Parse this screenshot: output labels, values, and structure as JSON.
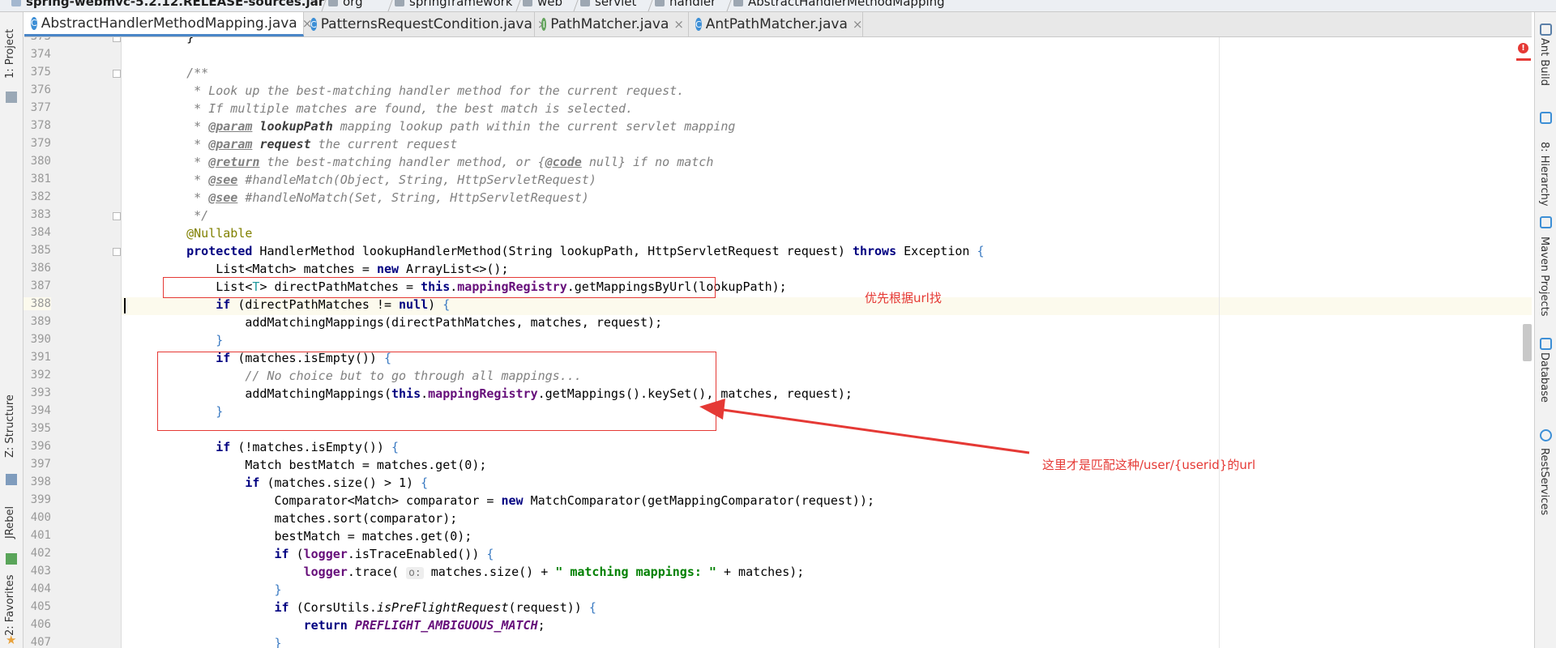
{
  "breadcrumb": [
    {
      "label": "spring-webmvc-5.2.12.RELEASE-sources.jar",
      "icon": "jar-icon"
    },
    {
      "label": "org",
      "icon": "package-icon"
    },
    {
      "label": "springframework",
      "icon": "package-icon"
    },
    {
      "label": "web",
      "icon": "package-icon"
    },
    {
      "label": "servlet",
      "icon": "package-icon"
    },
    {
      "label": "handler",
      "icon": "package-icon"
    },
    {
      "label": "AbstractHandlerMethodMapping",
      "icon": "class-icon"
    }
  ],
  "tabs": [
    {
      "label": "AbstractHandlerMethodMapping.java",
      "icon": "class-icon",
      "active": true
    },
    {
      "label": "PatternsRequestCondition.java",
      "icon": "class-icon",
      "active": false
    },
    {
      "label": "PathMatcher.java",
      "icon": "interface-icon",
      "active": false
    },
    {
      "label": "AntPathMatcher.java",
      "icon": "class-icon",
      "active": false
    }
  ],
  "left_tools": [
    {
      "label": "1: Project",
      "icon": "folder-icon"
    },
    {
      "label": "Z: Structure",
      "icon": "structure-icon"
    },
    {
      "label": "JRebel",
      "icon": "jrebel-icon"
    },
    {
      "label": "2: Favorites",
      "icon": "star-icon"
    }
  ],
  "right_tools": [
    {
      "label": "Ant Build",
      "icon": "ant-icon"
    },
    {
      "label": "8: Hierarchy",
      "icon": "hierarchy-icon"
    },
    {
      "label": "Maven Projects",
      "icon": "maven-icon"
    },
    {
      "label": "Database",
      "icon": "database-icon"
    },
    {
      "label": "RestServices",
      "icon": "rest-icon"
    }
  ],
  "editor": {
    "current_line": "388",
    "lines": [
      {
        "n": "373",
        "t": [
          {
            "c": "",
            "v": "    }"
          }
        ]
      },
      {
        "n": "374",
        "t": []
      },
      {
        "n": "375",
        "t": [
          {
            "c": "c",
            "v": "    /**"
          }
        ]
      },
      {
        "n": "376",
        "t": [
          {
            "c": "c",
            "v": "     * Look up the best-matching handler method for the current request."
          }
        ]
      },
      {
        "n": "377",
        "t": [
          {
            "c": "c",
            "v": "     * If multiple matches are found, the best match is selected."
          }
        ]
      },
      {
        "n": "378",
        "t": [
          {
            "c": "c",
            "v": "     * "
          },
          {
            "c": "cd",
            "v": "@param"
          },
          {
            "c": "c",
            "v": " "
          },
          {
            "c": "cb",
            "v": "lookupPath"
          },
          {
            "c": "c",
            "v": " mapping lookup path within the current servlet mapping"
          }
        ]
      },
      {
        "n": "379",
        "t": [
          {
            "c": "c",
            "v": "     * "
          },
          {
            "c": "cd",
            "v": "@param"
          },
          {
            "c": "c",
            "v": " "
          },
          {
            "c": "cb",
            "v": "request"
          },
          {
            "c": "c",
            "v": " the current request"
          }
        ]
      },
      {
        "n": "380",
        "t": [
          {
            "c": "c",
            "v": "     * "
          },
          {
            "c": "cd",
            "v": "@return"
          },
          {
            "c": "c",
            "v": " the best-matching handler method, or {"
          },
          {
            "c": "cd",
            "v": "@code"
          },
          {
            "c": "c",
            "v": " null} if no match"
          }
        ]
      },
      {
        "n": "381",
        "t": [
          {
            "c": "c",
            "v": "     * "
          },
          {
            "c": "cd",
            "v": "@see"
          },
          {
            "c": "c",
            "v": " #handleMatch(Object, String, HttpServletRequest)"
          }
        ]
      },
      {
        "n": "382",
        "t": [
          {
            "c": "c",
            "v": "     * "
          },
          {
            "c": "cd",
            "v": "@see"
          },
          {
            "c": "c",
            "v": " #handleNoMatch(Set, String, HttpServletRequest)"
          }
        ]
      },
      {
        "n": "383",
        "t": [
          {
            "c": "c",
            "v": "     */"
          }
        ]
      },
      {
        "n": "384",
        "t": [
          {
            "c": "an",
            "v": "    @Nullable"
          }
        ]
      },
      {
        "n": "385",
        "t": [
          {
            "c": "k",
            "v": "    protected"
          },
          {
            "c": "",
            "v": " HandlerMethod lookupHandlerMethod(String lookupPath, HttpServletRequest request) "
          },
          {
            "c": "k",
            "v": "throws"
          },
          {
            "c": "",
            "v": " Exception "
          },
          {
            "c": "br",
            "v": "{"
          }
        ]
      },
      {
        "n": "386",
        "t": [
          {
            "c": "",
            "v": "        List<Match> matches = "
          },
          {
            "c": "k",
            "v": "new"
          },
          {
            "c": "",
            "v": " ArrayList<>();"
          }
        ]
      },
      {
        "n": "387",
        "t": [
          {
            "c": "",
            "v": "        List<"
          },
          {
            "c": "g",
            "v": "T"
          },
          {
            "c": "",
            "v": "> directPathMatches = "
          },
          {
            "c": "k",
            "v": "this"
          },
          {
            "c": "",
            "v": "."
          },
          {
            "c": "f",
            "v": "mappingRegistry"
          },
          {
            "c": "",
            "v": ".getMappingsByUrl(lookupPath);"
          }
        ]
      },
      {
        "n": "388",
        "t": [
          {
            "c": "k",
            "v": "        if"
          },
          {
            "c": "",
            "v": " (directPathMatches != "
          },
          {
            "c": "k",
            "v": "null"
          },
          {
            "c": "",
            "v": ") "
          },
          {
            "c": "br",
            "v": "{"
          }
        ]
      },
      {
        "n": "389",
        "t": [
          {
            "c": "",
            "v": "            addMatchingMappings(directPathMatches, matches, request);"
          }
        ]
      },
      {
        "n": "390",
        "t": [
          {
            "c": "br",
            "v": "        }"
          }
        ]
      },
      {
        "n": "391",
        "t": [
          {
            "c": "k",
            "v": "        if"
          },
          {
            "c": "",
            "v": " (matches.isEmpty()) "
          },
          {
            "c": "br",
            "v": "{"
          }
        ]
      },
      {
        "n": "392",
        "t": [
          {
            "c": "c",
            "v": "            // No choice but to go through all mappings..."
          }
        ]
      },
      {
        "n": "393",
        "t": [
          {
            "c": "",
            "v": "            addMatchingMappings("
          },
          {
            "c": "k",
            "v": "this"
          },
          {
            "c": "",
            "v": "."
          },
          {
            "c": "f",
            "v": "mappingRegistry"
          },
          {
            "c": "",
            "v": ".getMappings().keySet(), matches, request);"
          }
        ]
      },
      {
        "n": "394",
        "t": [
          {
            "c": "br",
            "v": "        }"
          }
        ]
      },
      {
        "n": "395",
        "t": []
      },
      {
        "n": "396",
        "t": [
          {
            "c": "k",
            "v": "        if"
          },
          {
            "c": "",
            "v": " (!matches.isEmpty()) "
          },
          {
            "c": "br",
            "v": "{"
          }
        ]
      },
      {
        "n": "397",
        "t": [
          {
            "c": "",
            "v": "            Match bestMatch = matches.get(0);"
          }
        ]
      },
      {
        "n": "398",
        "t": [
          {
            "c": "k",
            "v": "            if"
          },
          {
            "c": "",
            "v": " (matches.size() > 1) "
          },
          {
            "c": "br",
            "v": "{"
          }
        ]
      },
      {
        "n": "399",
        "t": [
          {
            "c": "",
            "v": "                Comparator<Match> comparator = "
          },
          {
            "c": "k",
            "v": "new"
          },
          {
            "c": "",
            "v": " MatchComparator(getMappingComparator(request));"
          }
        ]
      },
      {
        "n": "400",
        "t": [
          {
            "c": "",
            "v": "                matches.sort(comparator);"
          }
        ]
      },
      {
        "n": "401",
        "t": [
          {
            "c": "",
            "v": "                bestMatch = matches.get(0);"
          }
        ]
      },
      {
        "n": "402",
        "t": [
          {
            "c": "k",
            "v": "                if"
          },
          {
            "c": "",
            "v": " ("
          },
          {
            "c": "f",
            "v": "logger"
          },
          {
            "c": "",
            "v": ".isTraceEnabled()) "
          },
          {
            "c": "br",
            "v": "{"
          }
        ]
      },
      {
        "n": "403",
        "t": [
          {
            "c": "",
            "v": "                    "
          },
          {
            "c": "f",
            "v": "logger"
          },
          {
            "c": "",
            "v": ".trace( "
          },
          {
            "c": "hint",
            "v": "o:"
          },
          {
            "c": "",
            "v": " matches.size() + "
          },
          {
            "c": "s",
            "v": "\" matching mappings: \""
          },
          {
            "c": "",
            "v": " + matches);"
          }
        ]
      },
      {
        "n": "404",
        "t": [
          {
            "c": "br",
            "v": "                }"
          }
        ]
      },
      {
        "n": "405",
        "t": [
          {
            "c": "k",
            "v": "                if"
          },
          {
            "c": "",
            "v": " (CorsUtils."
          },
          {
            "c": "it",
            "v": "isPreFlightRequest"
          },
          {
            "c": "",
            "v": "(request)) "
          },
          {
            "c": "br",
            "v": "{"
          }
        ]
      },
      {
        "n": "406",
        "t": [
          {
            "c": "k",
            "v": "                    return"
          },
          {
            "c": "",
            "v": " "
          },
          {
            "c": "st",
            "v": "PREFLIGHT_AMBIGUOUS_MATCH"
          },
          {
            "c": "",
            "v": ";"
          }
        ]
      },
      {
        "n": "407",
        "t": [
          {
            "c": "br",
            "v": "                }"
          }
        ]
      }
    ]
  },
  "annotations": {
    "note_direct": "优先根据url找",
    "note_pattern": "这里才是匹配这种/user/{userid}的url",
    "color": "#e53935"
  }
}
